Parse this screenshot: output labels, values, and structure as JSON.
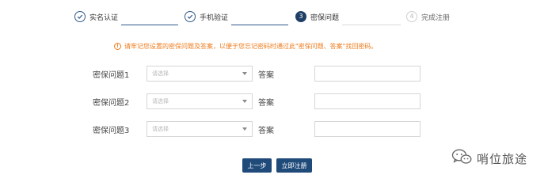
{
  "stepper": {
    "steps": [
      {
        "label": "实名认证",
        "number": "1",
        "state": "done"
      },
      {
        "label": "手机验证",
        "number": "2",
        "state": "done"
      },
      {
        "label": "密保问题",
        "number": "3",
        "state": "active"
      },
      {
        "label": "完成注册",
        "number": "4",
        "state": "todo"
      }
    ]
  },
  "notice": {
    "icon": "exclamation-circle-icon",
    "text": "请牢记您设置的密保问题及答案，以便于您忘记密码时通过此\"密保问题、答案\"找回密码。"
  },
  "questions": [
    {
      "label": "密保问题1",
      "placeholder": "请选择",
      "answer_label": "答案",
      "answer_value": ""
    },
    {
      "label": "密保问题2",
      "placeholder": "请选择",
      "answer_label": "答案",
      "answer_value": ""
    },
    {
      "label": "密保问题3",
      "placeholder": "请选择",
      "answer_label": "答案",
      "answer_value": ""
    }
  ],
  "buttons": {
    "prev_label": "上一步",
    "next_label": "立即注册"
  },
  "watermark": {
    "text": "哨位旅途",
    "icon": "wechat-icon"
  },
  "colors": {
    "primary": "#1f4a7a",
    "step_done": "#2f5a88",
    "warning": "#ee7a1a"
  }
}
